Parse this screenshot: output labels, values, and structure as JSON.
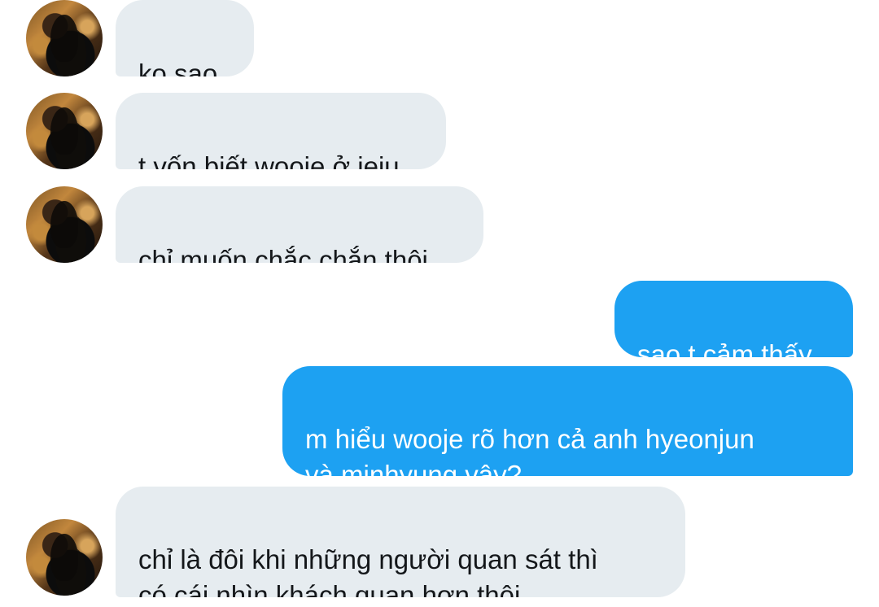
{
  "conversation": {
    "messages": [
      {
        "direction": "incoming",
        "text": "ko sao"
      },
      {
        "direction": "incoming",
        "text": "t vốn biết wooje ở jeju"
      },
      {
        "direction": "incoming",
        "text": "chỉ muốn chắc chắn thôi"
      },
      {
        "direction": "outgoing",
        "text": "sao t cảm thấy"
      },
      {
        "direction": "outgoing",
        "text": "m hiểu wooje rõ hơn cả anh hyeonjun\nvà minhyung vậy?"
      },
      {
        "direction": "incoming",
        "text": "chỉ là đôi khi những người quan sát thì\ncó cái nhìn khách quan hơn thôi"
      }
    ]
  },
  "colors": {
    "incoming_bubble": "#e6ecf0",
    "outgoing_bubble": "#1da1f2",
    "incoming_text": "#14171a",
    "outgoing_text": "#ffffff",
    "background": "#ffffff"
  },
  "icons": {
    "avatar": "contact-avatar"
  }
}
